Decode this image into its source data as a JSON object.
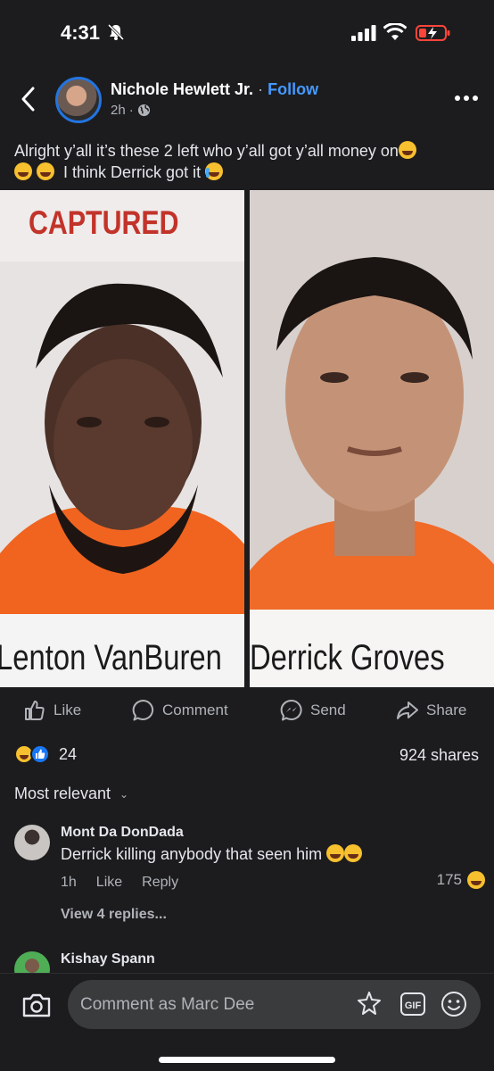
{
  "status_bar": {
    "time": "4:31"
  },
  "post": {
    "author": "Nichole Hewlett Jr.",
    "separator": "·",
    "follow_label": "Follow",
    "timestamp": "2h",
    "meta_dot": "·",
    "caption_line1": "Alright y’all it’s these 2 left who y’all got y’all money on",
    "caption_line2": "I think Derrick got it",
    "photo_left": {
      "banner": "CAPTURED",
      "name": "Lenton VanBuren"
    },
    "photo_right": {
      "name": "Derrick Groves"
    }
  },
  "actions": {
    "like": "Like",
    "comment": "Comment",
    "send": "Send",
    "share": "Share"
  },
  "stats": {
    "reaction_count": "24",
    "shares": "924 shares"
  },
  "sort_label": "Most relevant",
  "comments": [
    {
      "name": "Mont Da DonDada",
      "text": "Derrick killing anybody that seen him",
      "time": "1h",
      "like_label": "Like",
      "reply_label": "Reply",
      "reaction_count": "175",
      "view_replies": "View 4 replies..."
    },
    {
      "name": "Kishay Spann"
    }
  ],
  "composer": {
    "placeholder": "Comment as Marc Dee"
  },
  "colors": {
    "background": "#1c1c1e",
    "accent": "#4599ff",
    "muted": "#b0b3b8"
  }
}
